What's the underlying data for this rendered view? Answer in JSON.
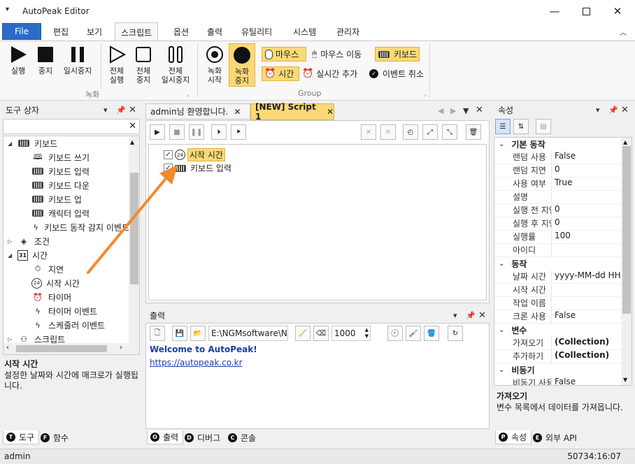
{
  "app": {
    "title": "AutoPeak Editor",
    "file_label": "File"
  },
  "menu": [
    "편집",
    "보기",
    "스크립트",
    "옵션",
    "출력",
    "유틸리티",
    "시스템",
    "관리자"
  ],
  "ribbon": {
    "record_group": {
      "label": "녹화",
      "buttons": [
        {
          "line1": "실행",
          "line2": "",
          "icon": "play-icon"
        },
        {
          "line1": "중지",
          "line2": "",
          "icon": "stop-icon"
        },
        {
          "line1": "일시중지",
          "line2": "",
          "icon": "pause-icon"
        },
        {
          "line1": "전체",
          "line2": "실행",
          "icon": "play-outline-icon"
        },
        {
          "line1": "전체",
          "line2": "중지",
          "icon": "stop-outline-icon"
        },
        {
          "line1": "전체",
          "line2": "일시중지",
          "icon": "pause-outline-icon"
        }
      ]
    },
    "group": {
      "label": "Group",
      "rec_start_l1": "녹화",
      "rec_start_l2": "시작",
      "rec_stop_l1": "녹화",
      "rec_stop_l2": "중지",
      "mouse": "마우스",
      "mouse_move": "마우스 이동",
      "keyboard": "키보드",
      "time": "시간",
      "realtime_add": "실시간 추가",
      "event_cancel": "이벤트 취소"
    }
  },
  "toolbox": {
    "title": "도구 상자",
    "items": [
      {
        "label": "키보드",
        "level": 0,
        "expander": "◢",
        "icon": "keyboard-icon"
      },
      {
        "label": "키보드 쓰기",
        "level": 1,
        "icon": "book-icon"
      },
      {
        "label": "키보드 입력",
        "level": 1,
        "icon": "keyboard-icon"
      },
      {
        "label": "키보드 다운",
        "level": 1,
        "icon": "keyboard-down-icon"
      },
      {
        "label": "키보드 업",
        "level": 1,
        "icon": "keyboard-up-icon"
      },
      {
        "label": "캐릭터 입력",
        "level": 1,
        "icon": "keyboard-icon"
      },
      {
        "label": "키보드 동작 감지 이벤트",
        "level": 1,
        "icon": "lightning-icon"
      },
      {
        "label": "조건",
        "level": 0,
        "expander": "▷",
        "icon": "condition-icon"
      },
      {
        "label": "시간",
        "level": 0,
        "expander": "◢",
        "icon": "calendar-icon"
      },
      {
        "label": "지연",
        "level": 1,
        "icon": "timer-icon"
      },
      {
        "label": "시작 시간",
        "level": 1,
        "icon": "clock-24-icon"
      },
      {
        "label": "타이머",
        "level": 1,
        "icon": "alarm-icon"
      },
      {
        "label": "타이머 이벤트",
        "level": 1,
        "icon": "lightning-icon"
      },
      {
        "label": "스케줄러 이벤트",
        "level": 1,
        "icon": "lightning-icon"
      },
      {
        "label": "스크립트",
        "level": 0,
        "expander": "▷",
        "icon": "script-icon"
      }
    ],
    "desc_title": "시작 시간",
    "desc_text": "설정한 날짜와 시간에 매크로가 실행됩니다.",
    "tabs": [
      {
        "letter": "T",
        "label": "도구"
      },
      {
        "letter": "F",
        "label": "함수"
      }
    ]
  },
  "doc_tabs": [
    {
      "label": "admin님 환영합니다."
    },
    {
      "label": "[NEW] Script 1"
    }
  ],
  "script": {
    "items": [
      {
        "label": "시작 시간",
        "icon": "clock-24-icon"
      },
      {
        "label": "키보드 입력",
        "icon": "keyboard-icon"
      }
    ]
  },
  "output": {
    "title": "출력",
    "path": "E:\\NGMsoftware\\NG",
    "count": "1000",
    "welcome": "Welcome to AutoPeak!",
    "link": "https://autopeak.co.kr",
    "tabs": [
      {
        "letter": "O",
        "label": "출력"
      },
      {
        "letter": "D",
        "label": "디버그"
      },
      {
        "letter": "C",
        "label": "콘솔"
      }
    ]
  },
  "props": {
    "title": "속성",
    "categories": [
      {
        "name": "기본 동작",
        "rows": [
          {
            "name": "랜덤 사용",
            "value": "False"
          },
          {
            "name": "랜덤 지연",
            "value": "0"
          },
          {
            "name": "사용 여부",
            "value": "True"
          },
          {
            "name": "설명",
            "value": ""
          },
          {
            "name": "실행 전 지연",
            "value": "0"
          },
          {
            "name": "실행 후 지연",
            "value": "0"
          },
          {
            "name": "실행률",
            "value": "100"
          },
          {
            "name": "아이디",
            "value": ""
          }
        ]
      },
      {
        "name": "동작",
        "rows": [
          {
            "name": "날짜 시간",
            "value": "yyyy-MM-dd HH:"
          },
          {
            "name": "시작 시간",
            "value": ""
          },
          {
            "name": "작업 이름",
            "value": ""
          },
          {
            "name": "크론 사용",
            "value": "False"
          }
        ]
      },
      {
        "name": "변수",
        "rows": [
          {
            "name": "가져오기",
            "value": "(Collection)",
            "bold": true
          },
          {
            "name": "추가하기",
            "value": "(Collection)",
            "bold": true
          }
        ]
      },
      {
        "name": "비동기",
        "rows": [
          {
            "name": "비동기 사용",
            "value": "False"
          }
        ]
      }
    ],
    "desc_title": "가져오기",
    "desc_text": "변수 목록에서 데이터를 가져옵니다.",
    "tabs": [
      {
        "letter": "P",
        "label": "속성"
      },
      {
        "letter": "E",
        "label": "외부 API"
      }
    ]
  },
  "status": {
    "user": "admin",
    "time": "50734:16:07"
  },
  "colors": {
    "accent": "#2b6cc8",
    "highlight": "#fbd977",
    "arrow": "#f38a2c",
    "welcome": "#1a3ea8"
  }
}
